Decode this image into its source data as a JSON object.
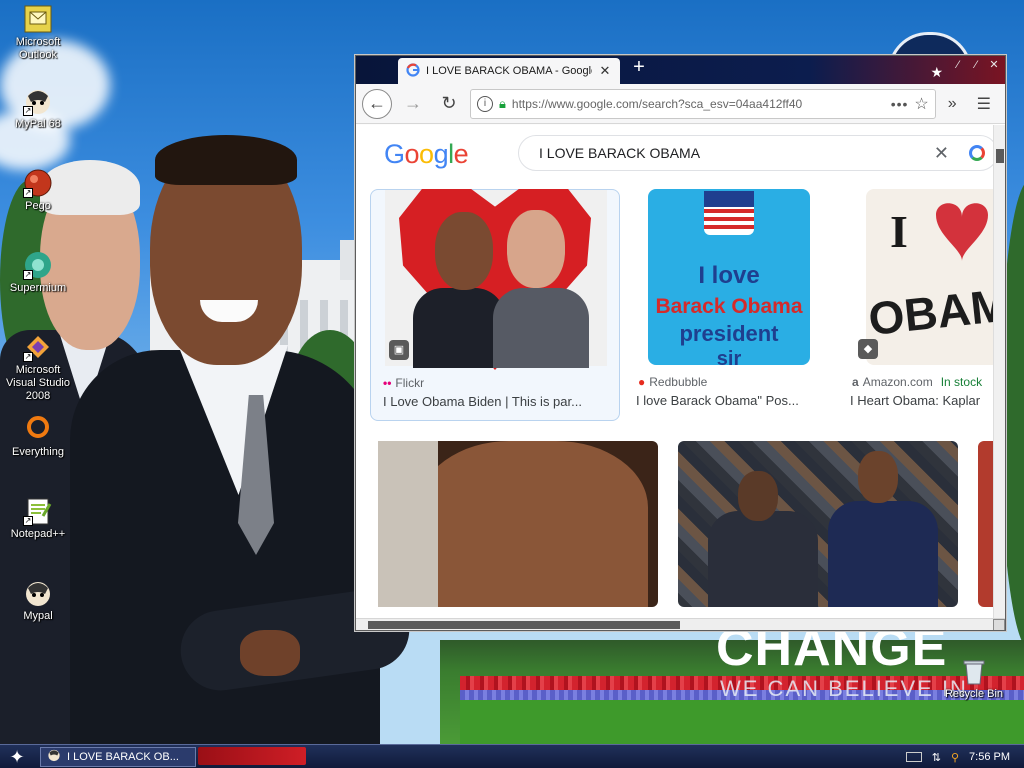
{
  "desktop": {
    "wallpaper_text": {
      "title": "CHANGE",
      "subtitle": "WE CAN BELIEVE IN"
    },
    "icons": [
      {
        "label": "Microsoft Outlook",
        "icon": "outlook-icon"
      },
      {
        "label": "MyPal 68",
        "icon": "mypal-icon"
      },
      {
        "label": "Pego",
        "icon": "pego-icon"
      },
      {
        "label": "Supermium",
        "icon": "supermium-icon"
      },
      {
        "label": "Microsoft Visual Studio 2008",
        "icon": "visual-studio-icon"
      },
      {
        "label": "Everything",
        "icon": "everything-search-icon"
      },
      {
        "label": "Notepad++",
        "icon": "notepadpp-icon"
      },
      {
        "label": "Mypal",
        "icon": "mypal-icon"
      }
    ],
    "recycle_bin": {
      "label": "Recycle Bin",
      "icon": "recycle-bin-icon"
    }
  },
  "browser": {
    "tab": {
      "title": "I LOVE BARACK OBAMA - Google S",
      "favicon": "google-favicon-icon"
    },
    "url": "https://www.google.com/search?sca_esv=04aa412ff40",
    "google": {
      "query": "I LOVE BARACK OBAMA",
      "results": [
        {
          "source": "Flickr",
          "caption": "I Love Obama Biden | This is par..."
        },
        {
          "source": "Redbubble",
          "caption": "I love Barack Obama\" Pos..."
        },
        {
          "source": "Amazon.com",
          "caption": "I Heart Obama: Kaplar",
          "extra": "In stock"
        }
      ],
      "image_texts": {
        "poster": {
          "line1": "I love",
          "line2": "Barack Obama",
          "line3": "president",
          "line4": "sir"
        },
        "book": {
          "line1": "I",
          "line2": "OBAMA"
        }
      }
    }
  },
  "taskbar": {
    "task": "I LOVE BARACK OB...",
    "clock": "7:56 PM"
  },
  "colors": {
    "accent_blue": "#4285f4",
    "taskbar": "#101a3a",
    "title_red": "#7a1422"
  }
}
